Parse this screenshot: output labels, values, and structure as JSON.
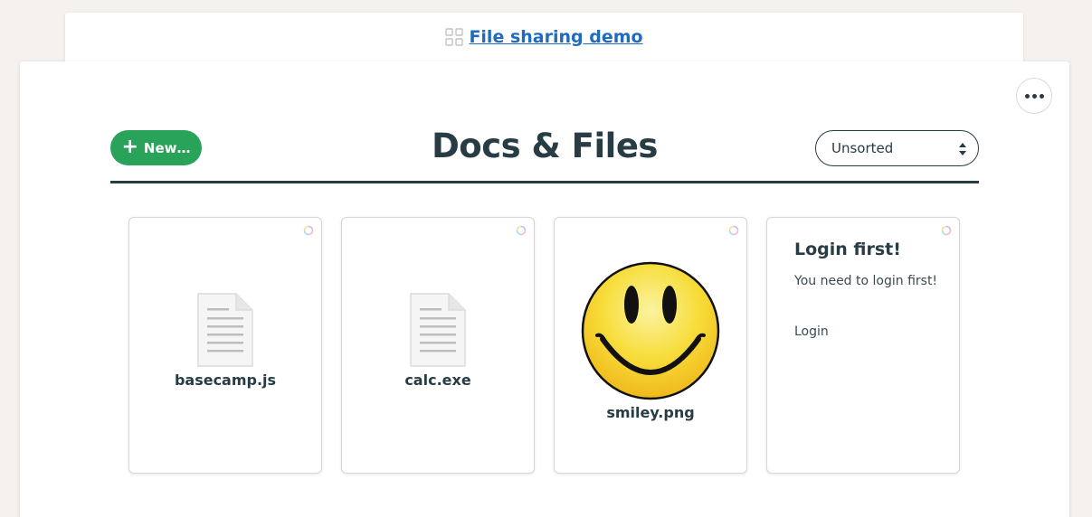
{
  "project": {
    "name": "File sharing demo"
  },
  "toolbar": {
    "new_label": "New…",
    "title": "Docs & Files",
    "sort": {
      "selected": "Unsorted"
    }
  },
  "files": [
    {
      "name": "basecamp.js",
      "kind": "document"
    },
    {
      "name": "calc.exe",
      "kind": "document"
    },
    {
      "name": "smiley.png",
      "kind": "image"
    }
  ],
  "login_card": {
    "title": "Login first!",
    "message": "You need to login first!",
    "link": "Login"
  },
  "colors": {
    "accent_green": "#29a35a",
    "link_blue": "#1f6bc0",
    "heading": "#283c46",
    "background": "#f4f1ee"
  }
}
